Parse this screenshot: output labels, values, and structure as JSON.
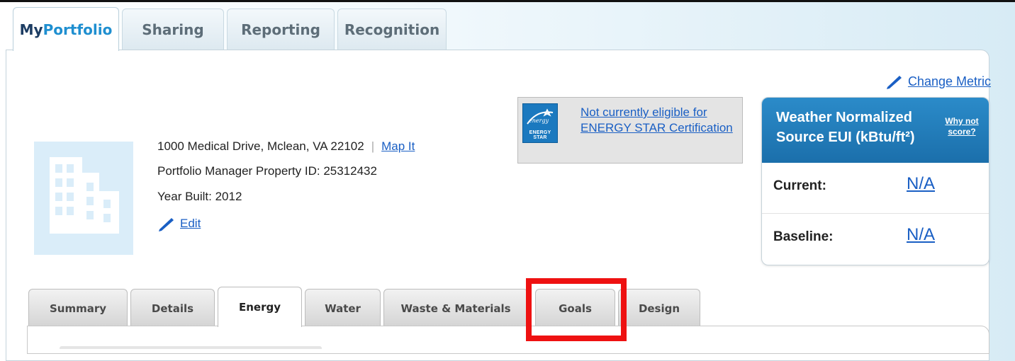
{
  "top_tabs": [
    {
      "label_prefix": "My",
      "label_accent": "Portfolio"
    },
    {
      "label": "Sharing"
    },
    {
      "label": "Reporting"
    },
    {
      "label": "Recognition"
    }
  ],
  "change_metric": "Change Metric",
  "property": {
    "address": "1000 Medical Drive, Mclean, VA 22102",
    "separator": "|",
    "map_link": "Map It",
    "id_line": "Portfolio Manager Property ID: 25312432",
    "year_built": "Year Built: 2012",
    "edit_link": "Edit"
  },
  "energy_star": {
    "logo_text": "ENERGY STAR",
    "message": "Not currently eligible for ENERGY STAR Certification"
  },
  "metric_card": {
    "title_line1": "Weather Normalized",
    "title_line2": "Source EUI (kBtu/ft²)",
    "why_line1": "Why not",
    "why_line2": "score?",
    "current_label": "Current:",
    "current_value": "N/A",
    "baseline_label": "Baseline:",
    "baseline_value": "N/A"
  },
  "sub_tabs": [
    "Summary",
    "Details",
    "Energy",
    "Water",
    "Waste & Materials",
    "Goals",
    "Design"
  ],
  "active_sub_tab": "Energy",
  "colors": {
    "header_blue": "#1b6fab",
    "link_blue": "#1a5fc4",
    "highlight_red": "#ee1111",
    "building_placeholder": "#daedf9"
  }
}
